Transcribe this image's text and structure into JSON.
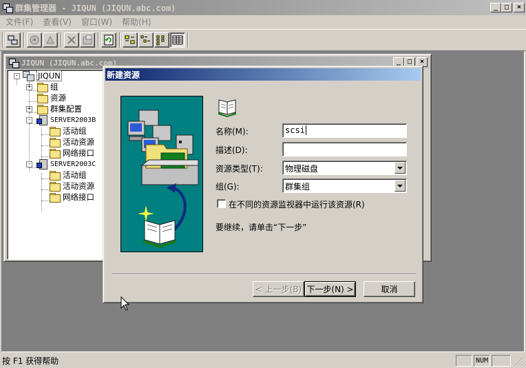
{
  "main_window": {
    "title": "群集管理器 - JIQUN (JIQUN.abc.com)",
    "controls": {
      "minimize": "_",
      "maximize": "□",
      "close": "×"
    }
  },
  "menu": {
    "items": [
      "文件(F)",
      "查看(V)",
      "窗口(W)",
      "帮助(H)"
    ]
  },
  "toolbar": {
    "buttons": [
      "cluster-icon",
      "bring-online-icon",
      "take-offline-icon",
      "delete-icon",
      "properties-icon",
      "refresh-icon",
      "large-icons-icon",
      "small-icons-icon",
      "list-icon",
      "details-icon"
    ]
  },
  "child_window": {
    "title": "JIQUN (JIQUN.abc.com)"
  },
  "tree": {
    "root": "JIQUN",
    "items": [
      {
        "label": "组",
        "expander": "+"
      },
      {
        "label": "资源"
      },
      {
        "label": "群集配置",
        "expander": "+"
      },
      {
        "label": "SERVER2003B",
        "expander": "-"
      },
      {
        "label": "活动组"
      },
      {
        "label": "活动资源"
      },
      {
        "label": "网络接口"
      },
      {
        "label": "SERVER2003C",
        "expander": "-"
      },
      {
        "label": "活动组"
      },
      {
        "label": "活动资源"
      },
      {
        "label": "网络接口"
      }
    ]
  },
  "dialog": {
    "title": "新建资源",
    "fields": {
      "name_label": "名称(M):",
      "name_value": "scsi",
      "desc_label": "描述(D):",
      "desc_value": "",
      "type_label": "资源类型(T):",
      "type_value": "物理磁盘",
      "group_label": "组(G):",
      "group_value": "群集组"
    },
    "checkbox_label": "在不同的资源监视器中运行该资源(R)",
    "checkbox_checked": false,
    "hint": "要继续，请单击“下一步”",
    "buttons": {
      "back": "< 上一步(B)",
      "next": "下一步(N) >",
      "cancel": "取消"
    }
  },
  "status": {
    "text": "按 F1 获得帮助",
    "panel_num": "NUM"
  }
}
